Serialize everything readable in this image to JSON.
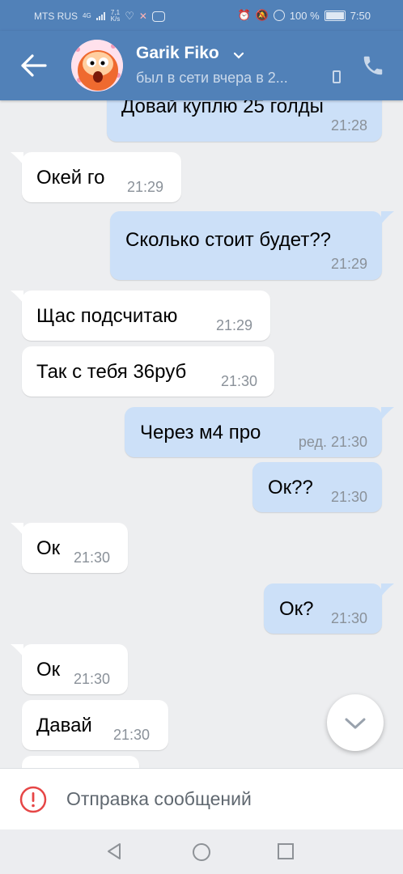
{
  "statusbar": {
    "carrier": "MTS RUS",
    "net_type": "4G",
    "speed": "7,1",
    "speed_unit": "K/s",
    "battery": "100 %",
    "time": "7:50"
  },
  "header": {
    "contact_name": "Garik Fiko",
    "last_seen": "был в сети вчера в 2..."
  },
  "messages": [
    {
      "dir": "out",
      "text": "Довай куплю 25 голды",
      "time": "21:28"
    },
    {
      "dir": "in",
      "text": "Окей го",
      "time": "21:29"
    },
    {
      "dir": "out",
      "text": "Сколько стоит будет??",
      "time": "21:29"
    },
    {
      "dir": "in",
      "text": "Щас подсчитаю",
      "time": "21:29"
    },
    {
      "dir": "in",
      "text": "Так с тебя 36руб",
      "time": "21:30"
    },
    {
      "dir": "out",
      "text": "Через м4 про",
      "time": "ред. 21:30"
    },
    {
      "dir": "out",
      "text": "Ок??",
      "time": "21:30"
    },
    {
      "dir": "in",
      "text": "Ок",
      "time": "21:30"
    },
    {
      "dir": "out",
      "text": "Ок?",
      "time": "21:30"
    },
    {
      "dir": "in",
      "text": "Ок",
      "time": "21:30"
    },
    {
      "dir": "in",
      "text": "Давай",
      "time": "21:30"
    }
  ],
  "sendbar": {
    "status_text": "Отправка сообщений"
  },
  "colors": {
    "header": "#5181b8",
    "outgoing": "#cce0f8",
    "incoming": "#ffffff",
    "background": "#edeef0",
    "error": "#e64646"
  }
}
